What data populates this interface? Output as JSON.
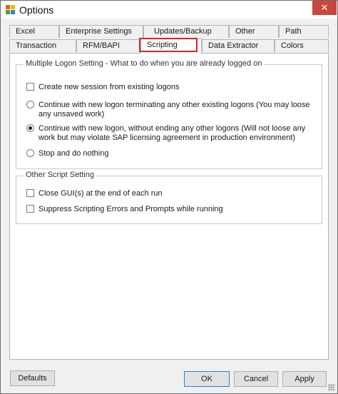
{
  "window": {
    "title": "Options",
    "close_glyph": "✕"
  },
  "tabs": {
    "row1": [
      "Excel",
      "Enterprise Settings",
      "Updates/Backup",
      "Other",
      "Path"
    ],
    "row2": [
      "Transaction",
      "RFM/BAPI",
      "Scripting",
      "Data Extractor",
      "Colors"
    ],
    "selected": "Scripting"
  },
  "logon_group": {
    "title": "Multiple Logon Setting - What to do when you are already logged on",
    "options": [
      {
        "type": "checkbox",
        "label": "Create new session from existing logons",
        "checked": false
      },
      {
        "type": "radio",
        "label": "Continue with new logon terminating any other existing logons (You may loose any unsaved work)",
        "checked": false
      },
      {
        "type": "radio",
        "label": "Continue with new logon, without ending any other logons (Will not loose any work but may violate SAP licensing agreement in production environment)",
        "checked": true
      },
      {
        "type": "radio",
        "label": "Stop and do nothing",
        "checked": false
      }
    ]
  },
  "script_group": {
    "title": "Other Script Setting",
    "options": [
      {
        "type": "checkbox",
        "label": "Close GUI(s) at the end of each run",
        "checked": false
      },
      {
        "type": "checkbox",
        "label": "Suppress Scripting Errors and Prompts while running",
        "checked": false
      }
    ]
  },
  "buttons": {
    "defaults": "Defaults",
    "ok": "OK",
    "cancel": "Cancel",
    "apply": "Apply"
  },
  "colors": {
    "close_button": "#c7463e",
    "highlight": "#d6252b",
    "icon_tl": "#e0612b",
    "icon_tr": "#f2b600",
    "icon_bl": "#5b9a2f",
    "icon_br": "#2e86c9"
  }
}
